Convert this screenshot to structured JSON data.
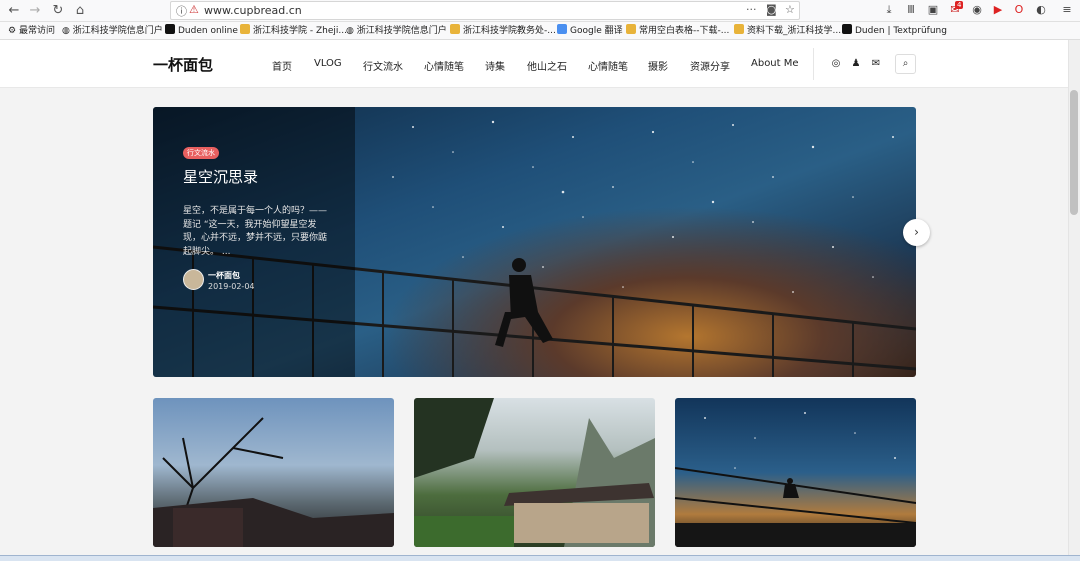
{
  "browser": {
    "url": "www.cupbread.cn",
    "icons": [
      "back-icon",
      "forward-icon",
      "reload-icon",
      "home-icon",
      "info-icon",
      "insecure-icon",
      "more-icon",
      "pocket-icon",
      "star-icon",
      "download-icon",
      "library-icon",
      "sidebar-icon",
      "notification-icon",
      "extension-icon",
      "youtube-icon",
      "opera-icon",
      "extension-icon",
      "hamburger-icon"
    ],
    "badge": "4"
  },
  "bookmarks": [
    {
      "label": "最常访问",
      "icon": "gear-icon"
    },
    {
      "label": "浙江科技学院信息门户",
      "icon": "globe-icon"
    },
    {
      "label": "Duden online",
      "icon": "d-icon"
    },
    {
      "label": "浙江科技学院 - Zheji...",
      "icon": "flag-icon"
    },
    {
      "label": "浙江科技学院信息门户",
      "icon": "globe-icon"
    },
    {
      "label": "浙江科技学院教务处-...",
      "icon": "flag-icon"
    },
    {
      "label": "Google 翻译",
      "icon": "google-icon"
    },
    {
      "label": "常用空白表格--下载-...",
      "icon": "flag-icon"
    },
    {
      "label": "资料下载_浙江科技学...",
      "icon": "flag-icon"
    },
    {
      "label": "Duden | Textprüfung",
      "icon": "d-icon"
    }
  ],
  "site": {
    "logo": "一杯面包",
    "menu": [
      "首页",
      "VLOG",
      "行文流水",
      "心情随笔",
      "诗集",
      "他山之石",
      "心情随笔",
      "摄影",
      "资源分享",
      "About Me"
    ],
    "social": [
      "weibo-icon",
      "qq-icon",
      "mail-icon"
    ]
  },
  "hero": {
    "tag": "行文流水",
    "title": "星空沉思录",
    "excerpt": "星空，不是属于每一个人的吗？——题记 “这一天，我开始仰望星空发现，心并不远，梦并不远，只要你踮起脚尖。 ...",
    "author": "一杯面包",
    "date": "2019-02-04"
  },
  "colors": {
    "accent": "#e86060",
    "text": "#222222",
    "bg": "#f3f3f3"
  }
}
